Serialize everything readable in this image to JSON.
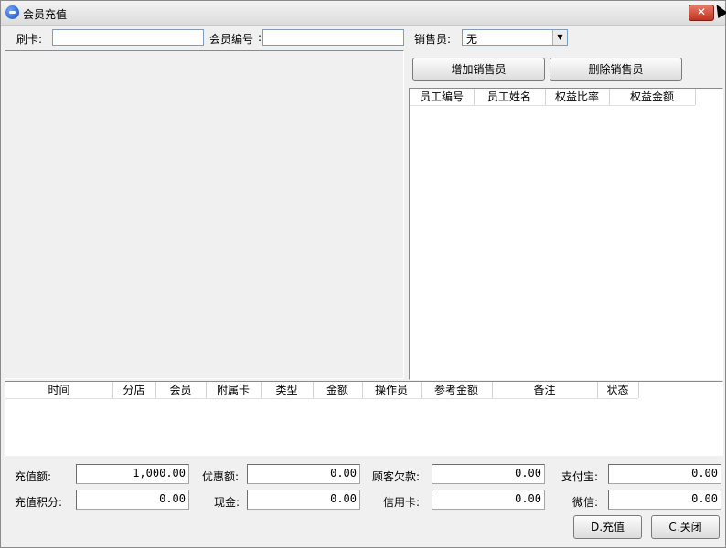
{
  "window": {
    "title": "会员充值"
  },
  "top": {
    "card_label": "刷卡:",
    "member_no_label": "会员编号",
    "card_value": "",
    "member_no_value": "",
    "salesperson_label": "销售员:",
    "salesperson_value": "无"
  },
  "buttons": {
    "add_sales": "增加销售员",
    "del_sales": "删除销售员",
    "recharge": "D.充值",
    "close": "C.关闭"
  },
  "staff_table": {
    "columns": [
      "员工编号",
      "员工姓名",
      "权益比率",
      "权益金额"
    ],
    "rows": []
  },
  "records_table": {
    "columns": [
      "时间",
      "分店",
      "会员",
      "附属卡",
      "类型",
      "金额",
      "操作员",
      "参考金额",
      "备注",
      "状态"
    ],
    "rows": []
  },
  "bottom": {
    "recharge_amount_label": "充值额:",
    "recharge_amount": "1,000.00",
    "discount_label": "优惠额:",
    "discount": "0.00",
    "debt_label": "顾客欠款:",
    "debt": "0.00",
    "alipay_label": "支付宝:",
    "alipay": "0.00",
    "points_label": "充值积分:",
    "points": "0.00",
    "cash_label": "现金:",
    "cash": "0.00",
    "credit_label": "信用卡:",
    "credit": "0.00",
    "wechat_label": "微信:",
    "wechat": "0.00"
  }
}
